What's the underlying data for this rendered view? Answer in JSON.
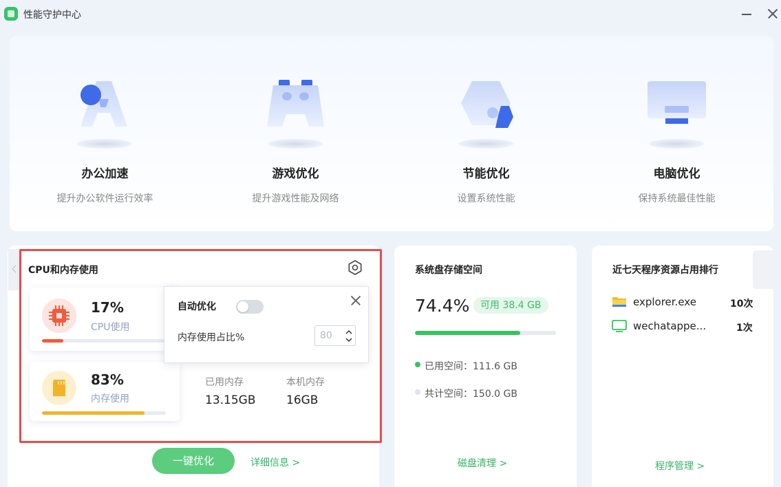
{
  "window": {
    "title": "性能守护中心"
  },
  "features": [
    {
      "name": "办公加速",
      "desc": "提升办公软件运行效率",
      "icon": "office-icon"
    },
    {
      "name": "游戏优化",
      "desc": "提升游戏性能及网络",
      "icon": "gamepad-icon"
    },
    {
      "name": "节能优化",
      "desc": "设置系统性能",
      "icon": "energy-icon"
    },
    {
      "name": "电脑优化",
      "desc": "保持系统最佳性能",
      "icon": "monitor-icon"
    }
  ],
  "cpu_card": {
    "title": "CPU和内存使用",
    "cpu": {
      "percent_text": "17%",
      "label": "CPU使用",
      "percent": 17,
      "color": "#f25a3c"
    },
    "memory": {
      "percent_text": "83%",
      "label": "内存使用",
      "percent": 83,
      "color": "#f0b429"
    },
    "used_memory_label": "已用内存",
    "used_memory_value": "13.15GB",
    "total_memory_label": "本机内存",
    "total_memory_value": "16GB",
    "optimize_button": "一键优化",
    "details_link": "详细信息 >"
  },
  "popup": {
    "title": "自动优化",
    "toggle_on": false,
    "threshold_label": "内存使用占比%",
    "threshold_value": "80"
  },
  "disk_card": {
    "title": "系统盘存储空间",
    "percent_text": "74.4%",
    "percent": 74.4,
    "free_badge": "可用 38.4 GB",
    "used_text": "已用空间：111.6 GB",
    "total_text": "共计空间：150.0 GB",
    "clean_link": "磁盘清理 >",
    "accent": "#34c45e"
  },
  "rank_card": {
    "title": "近七天程序资源占用排行",
    "items": [
      {
        "name": "explorer.exe",
        "count": "10次",
        "icon": "folder-icon"
      },
      {
        "name": "wechatappe...",
        "count": "1次",
        "icon": "wechat-app-icon"
      }
    ],
    "manage_link": "程序管理 >"
  }
}
